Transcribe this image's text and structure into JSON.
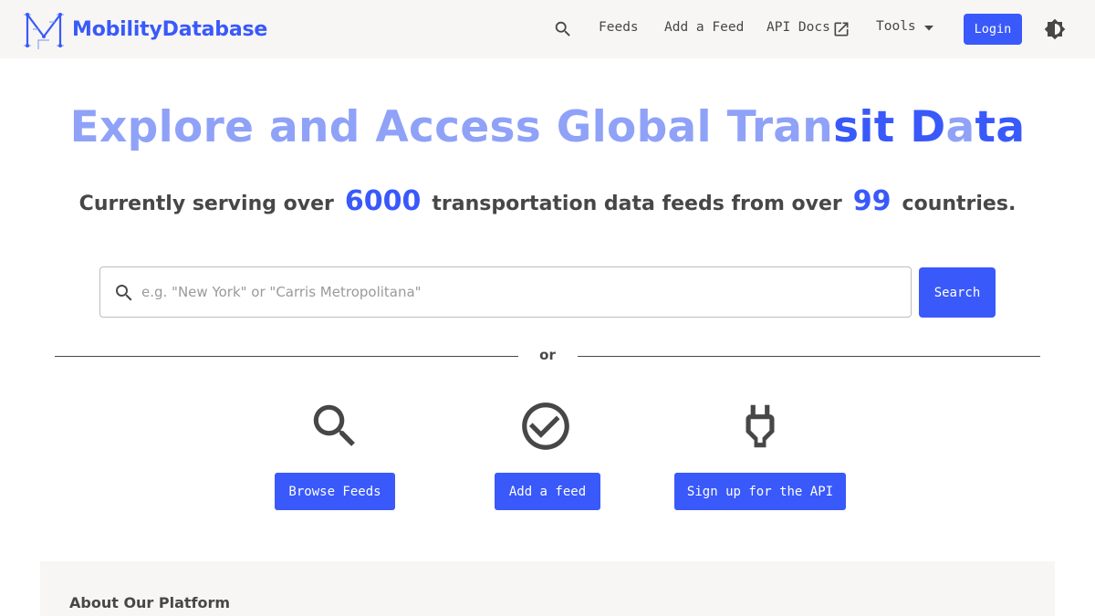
{
  "header": {
    "logo_text": "MobilityDatabase",
    "nav": {
      "feeds": "Feeds",
      "add_feed": "Add a Feed",
      "api_docs": "API Docs",
      "tools": "Tools",
      "login": "Login"
    },
    "icons": {
      "search": "search-icon",
      "external": "open-in-new-icon",
      "dropdown": "caret-down-icon",
      "theme": "brightness-contrast-icon"
    }
  },
  "hero": {
    "title_part1": "Explore and Access Global Tran",
    "title_part2": "sit D",
    "title_part3": "a",
    "title_part4": "ta",
    "sub_prefix": "Currently serving over",
    "feed_count": "6000",
    "sub_middle": "transportation data feeds from over",
    "country_count": "99",
    "sub_suffix": "countries."
  },
  "search": {
    "placeholder": "e.g. \"New York\" or \"Carris Metropolitana\"",
    "value": "",
    "button": "Search"
  },
  "divider": {
    "text": "or"
  },
  "actions": {
    "browse": "Browse Feeds",
    "add": "Add a feed",
    "signup": "Sign up for the API"
  },
  "about": {
    "title": "About Our Platform"
  },
  "colors": {
    "accent": "#3959fa",
    "accent_light": "#8fa2f8",
    "text": "#474747",
    "header_bg": "#f7f6f5"
  }
}
